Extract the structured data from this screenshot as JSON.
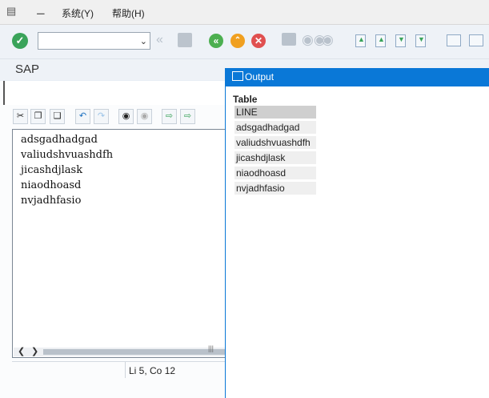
{
  "menubar": {
    "items": [
      {
        "label": "系统(Y)"
      },
      {
        "label": "帮助(H)"
      }
    ]
  },
  "title": "SAP",
  "editor": {
    "lines": [
      "adsgadhadgad",
      "valiudshvuashdfh",
      "jicashdjlask",
      "niaodhoasd",
      "nvjadhfasio"
    ],
    "status": "Li 5, Co 12"
  },
  "output": {
    "title": "Output",
    "table_label": "Table",
    "header": "LINE",
    "rows": [
      "adsgadhadgad",
      "valiudshvuashdfh",
      "jicashdjlask",
      "niaodhoasd",
      "nvjadhfasio"
    ]
  },
  "colors": {
    "accent": "#0a78d7",
    "ok_green": "#3aa35a",
    "nav_green": "#4caf50",
    "nav_orange": "#f0a020",
    "cancel_red": "#e05050"
  },
  "icons": [
    "menu-icon",
    "printer-icon",
    "ok-icon",
    "back-icon",
    "save-icon",
    "exit-icon",
    "up-icon",
    "cancel-icon",
    "print-icon",
    "find-icon",
    "find-next-icon",
    "page-icons",
    "layout-icons"
  ]
}
